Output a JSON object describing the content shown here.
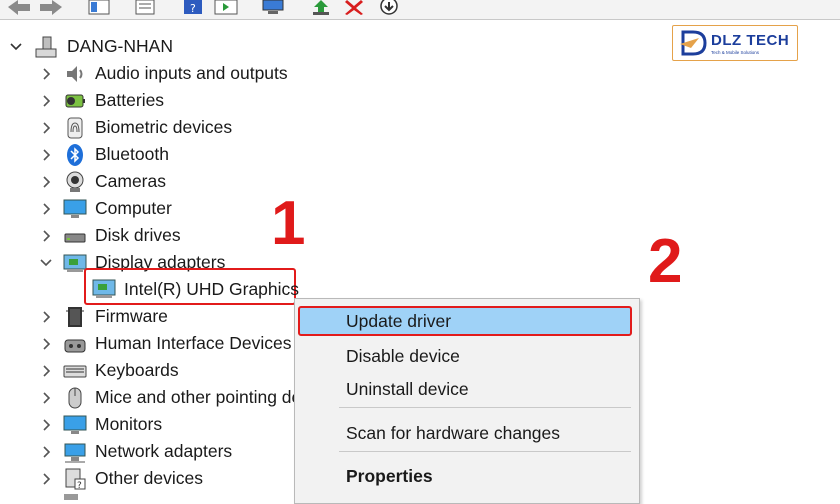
{
  "tree": {
    "root_label": "DANG-NHAN",
    "items": [
      {
        "label": "Audio inputs and outputs",
        "icon": "speaker-icon"
      },
      {
        "label": "Batteries",
        "icon": "battery-icon"
      },
      {
        "label": "Biometric devices",
        "icon": "fingerprint-icon"
      },
      {
        "label": "Bluetooth",
        "icon": "bluetooth-icon"
      },
      {
        "label": "Cameras",
        "icon": "camera-icon"
      },
      {
        "label": "Computer",
        "icon": "monitor-icon"
      },
      {
        "label": "Disk drives",
        "icon": "disk-drive-icon"
      },
      {
        "label": "Display adapters",
        "icon": "display-adapter-icon"
      },
      {
        "label": "Firmware",
        "icon": "chip-icon"
      },
      {
        "label": "Human Interface Devices",
        "icon": "hid-icon"
      },
      {
        "label": "Keyboards",
        "icon": "keyboard-icon"
      },
      {
        "label": "Mice and other pointing devices",
        "icon": "mouse-icon"
      },
      {
        "label": "Monitors",
        "icon": "monitor-icon"
      },
      {
        "label": "Network adapters",
        "icon": "network-icon"
      },
      {
        "label": "Other devices",
        "icon": "unknown-device-icon"
      }
    ],
    "selected_child": "Intel(R) UHD Graphics"
  },
  "context_menu": {
    "update": "Update driver",
    "disable": "Disable device",
    "uninstall": "Uninstall device",
    "scan": "Scan for hardware changes",
    "properties": "Properties"
  },
  "annotations": {
    "step1": "1",
    "step2": "2"
  },
  "logo": {
    "text": "DLZ TECH",
    "subtitle": "Tech & Mobile Solutions"
  },
  "colors": {
    "highlight_red": "#e21b1b",
    "menu_hover": "#9fd2f7",
    "logo_blue": "#1c3e9c",
    "logo_orange": "#e5a24a"
  }
}
